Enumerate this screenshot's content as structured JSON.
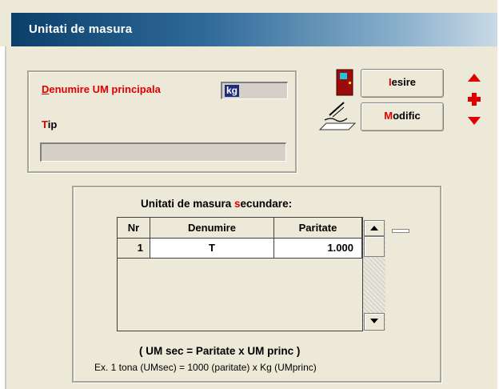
{
  "window": {
    "title": "Unitati de masura"
  },
  "main_form": {
    "label_denumire_hot": "D",
    "label_denumire_rest": "enumire UM principala",
    "um_value": "kg",
    "label_tip_hot": "T",
    "label_tip_rest": "ip",
    "tip_value": ""
  },
  "buttons": {
    "iesire_hot": "I",
    "iesire_rest": "esire",
    "modific_hot": "M",
    "modific_rest": "odific"
  },
  "secondary": {
    "title_pre": "Unitati de masura ",
    "title_hot": "s",
    "title_post": "ecundare:",
    "columns": [
      "Nr",
      "Denumire",
      "Paritate"
    ],
    "rows": [
      {
        "nr": "1",
        "denumire": "T",
        "paritate": "1.000"
      }
    ],
    "formula": "( UM sec = Paritate x UM princ )",
    "example": "Ex. 1 tona (UMsec) = 1000 (paritate) x Kg (UMprinc)"
  },
  "colors": {
    "accent_red": "#e00000",
    "title_bar": "#0b3f6a",
    "selection": "#1c2c7a"
  },
  "icons": [
    "door-exit-icon",
    "edit-pen-icon",
    "arrow-up-icon",
    "plus-icon",
    "arrow-down-icon"
  ]
}
